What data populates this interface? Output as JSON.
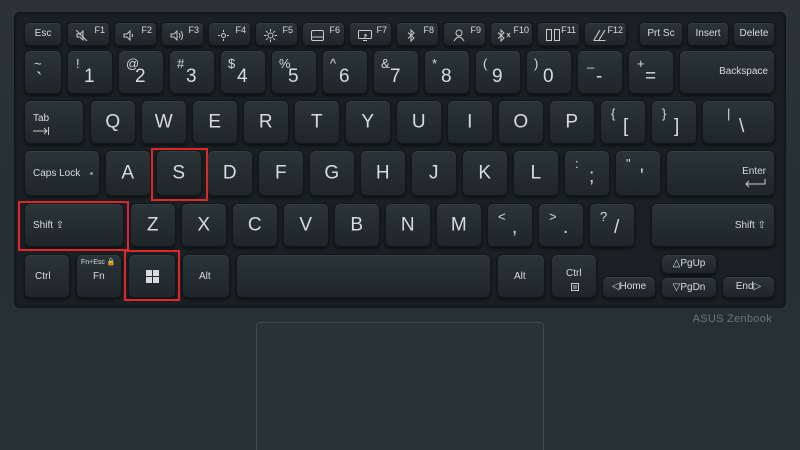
{
  "brand": "ASUS Zenbook",
  "highlight_color": "#e0262d",
  "keys": {
    "esc": "Esc",
    "f1": "F1",
    "f2": "F2",
    "f3": "F3",
    "f4": "F4",
    "f5": "F5",
    "f6": "F6",
    "f7": "F7",
    "f8": "F8",
    "f9": "F9",
    "f10": "F10",
    "f11": "F11",
    "f12": "F12",
    "prtsc": "Prt Sc",
    "insert": "Insert",
    "delete": "Delete",
    "backtick_top": "~",
    "backtick": "`",
    "n1_top": "!",
    "n1": "1",
    "n2_top": "@",
    "n2": "2",
    "n3_top": "#",
    "n3": "3",
    "n4_top": "$",
    "n4": "4",
    "n5_top": "%",
    "n5": "5",
    "n6_top": "^",
    "n6": "6",
    "n7_top": "&",
    "n7": "7",
    "n8_top": "*",
    "n8": "8",
    "n9_top": "(",
    "n9": "9",
    "n0_top": ")",
    "n0": "0",
    "minus_top": "_",
    "minus": "-",
    "equals_top": "+",
    "equals": "=",
    "backspace": "Backspace",
    "tab": "Tab",
    "q": "Q",
    "w": "W",
    "e": "E",
    "r": "R",
    "t": "T",
    "y": "Y",
    "u": "U",
    "i": "I",
    "o": "O",
    "p": "P",
    "lbracket_top": "{",
    "lbracket": "[",
    "rbracket_top": "}",
    "rbracket": "]",
    "backslash_top": "|",
    "backslash": "\\",
    "capslock": "Caps Lock",
    "a": "A",
    "s": "S",
    "d": "D",
    "f": "F",
    "g": "G",
    "h": "H",
    "j": "J",
    "k": "K",
    "l": "L",
    "semicolon_top": ":",
    "semicolon": ";",
    "quote_top": "\"",
    "quote": "'",
    "enter": "Enter",
    "lshift": "Shift ⇧",
    "z": "Z",
    "x": "X",
    "c": "C",
    "v": "V",
    "b": "B",
    "n": "N",
    "m": "M",
    "comma_top": "<",
    "comma": ",",
    "period_top": ">",
    "period": ".",
    "slash_top": "?",
    "slash": "/",
    "rshift": "Shift ⇧",
    "lctrl": "Ctrl",
    "fn_top": "Fn+Esc 🔒",
    "fn": "Fn",
    "lalt": "Alt",
    "ralt": "Alt",
    "rctrl": "Ctrl",
    "home": "◁Home",
    "pgup": "△PgUp",
    "pgdn": "▽PgDn",
    "end": "End▷"
  }
}
